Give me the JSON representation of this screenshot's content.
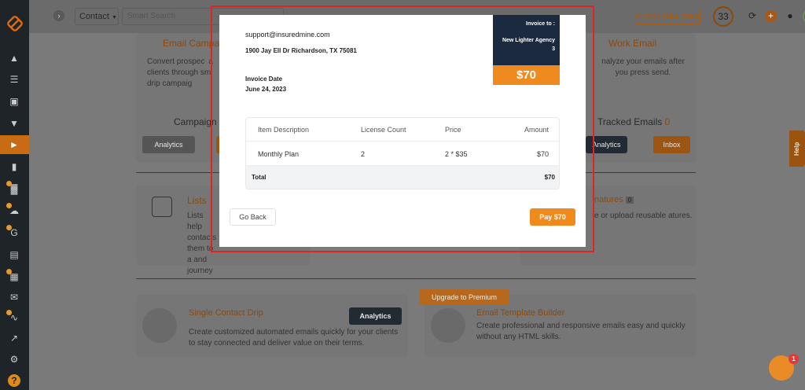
{
  "topbar": {
    "contact_select": "Contact",
    "search_placeholder": "Smart Search",
    "trial_badge": "14 DAYS FREE TRIAL",
    "count": "33"
  },
  "background": {
    "email_campaign_title": "Email Campa",
    "email_campaign_text": "Convert prospec a clients through sm drip campaig",
    "campaign_label": "Campaign",
    "analytics_label": "Analytics",
    "work_email_title": "Work Email",
    "work_email_text": "nalyze your emails after you press send.",
    "tracked_emails_label": "Tracked Emails",
    "tracked_emails_count": "0",
    "inbox_label": "Inbox",
    "lists_title": "Lists",
    "lists_text": "Lists help contacts them to a and journey",
    "signatures_title": "natures",
    "signatures_count": "0",
    "signatures_text": "e or upload reusable atures.",
    "single_drip_title": "Single Contact Drip",
    "single_drip_text": "Create customized automated emails quickly for your clients to stay connected and deliver value on their terms.",
    "template_builder_title": "Email Template Builder",
    "template_builder_text": "Create professional and responsive emails easy and quickly without any HTML skills.",
    "upgrade_label": "Upgrade to Premium",
    "help_label": "Help",
    "chat_badge": "1"
  },
  "invoice": {
    "email": "support@insuredmine.com",
    "address": "1900 Jay Ell Dr Richardson, TX 75081",
    "date_label": "Invoice Date",
    "date": "June 24, 2023",
    "to_label": "Invoice to :",
    "to_name": "New Lighter Agency 3",
    "amount": "$70",
    "headers": [
      "Item Description",
      "License Count",
      "Price",
      "Amount"
    ],
    "row": [
      "Monthly Plan",
      "2",
      "2 * $35",
      "$70"
    ],
    "total_label": "Total",
    "total_value": "$70",
    "go_back_label": "Go Back",
    "pay_label": "Pay $70"
  },
  "colors": {
    "accent": "#f08a1c",
    "navy": "#1b2a3e",
    "highlight": "#e02424"
  }
}
